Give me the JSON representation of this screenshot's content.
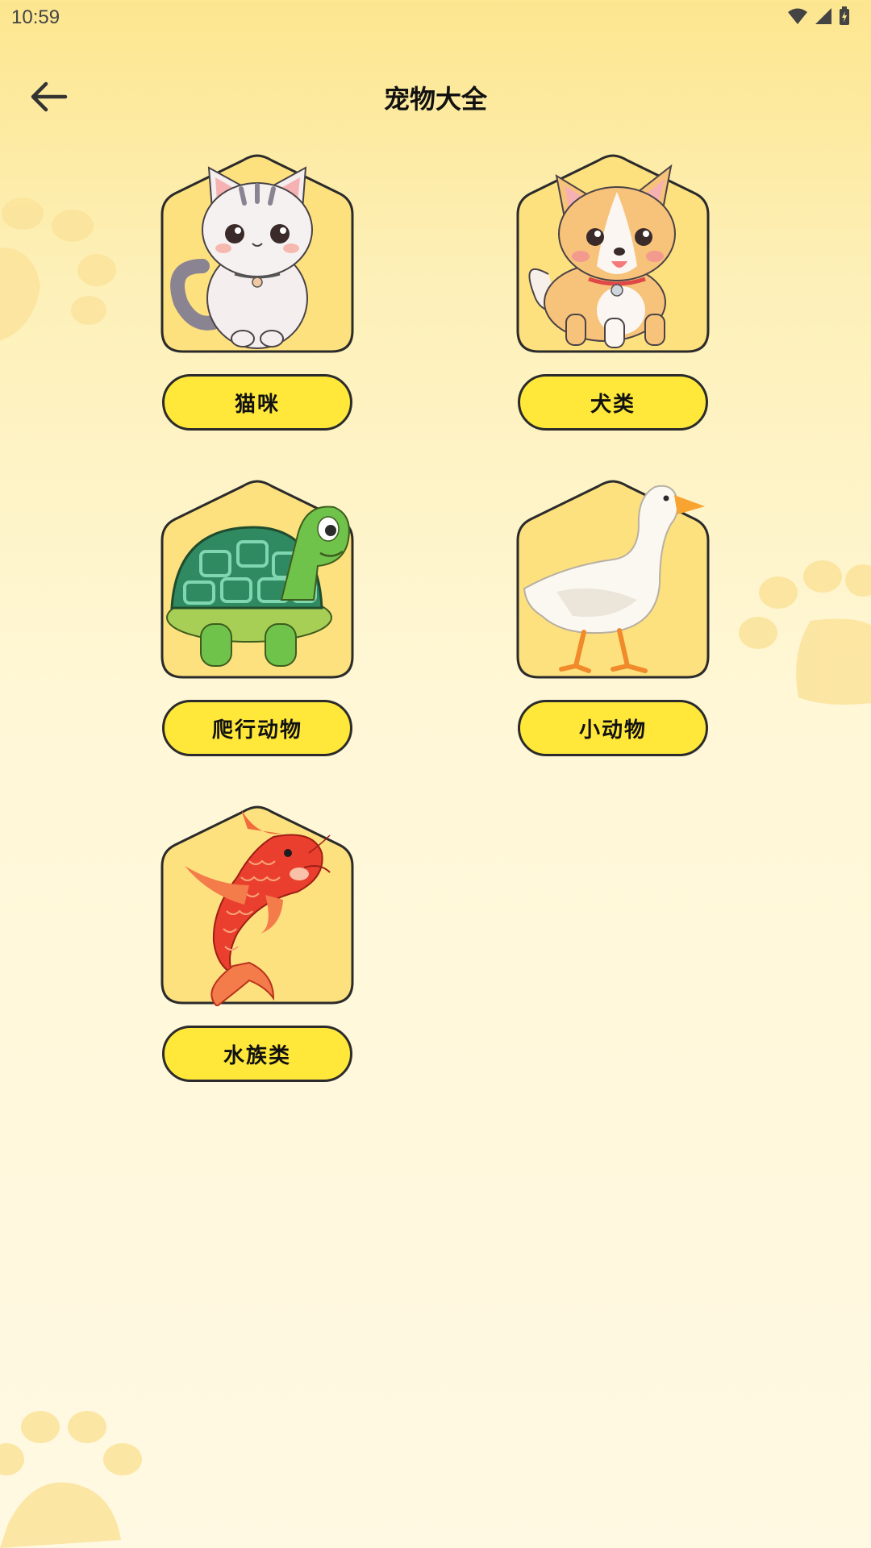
{
  "status_bar": {
    "time": "10:59"
  },
  "header": {
    "title": "宠物大全"
  },
  "categories": [
    {
      "label": "猫咪",
      "animal": "cat"
    },
    {
      "label": "犬类",
      "animal": "dog"
    },
    {
      "label": "爬行动物",
      "animal": "turtle"
    },
    {
      "label": "小动物",
      "animal": "duck"
    },
    {
      "label": "水族类",
      "animal": "koi"
    }
  ],
  "colors": {
    "button": "#ffe83a",
    "card": "#fde17f",
    "outline": "#2b2b2b",
    "background": "#fff7d6"
  }
}
